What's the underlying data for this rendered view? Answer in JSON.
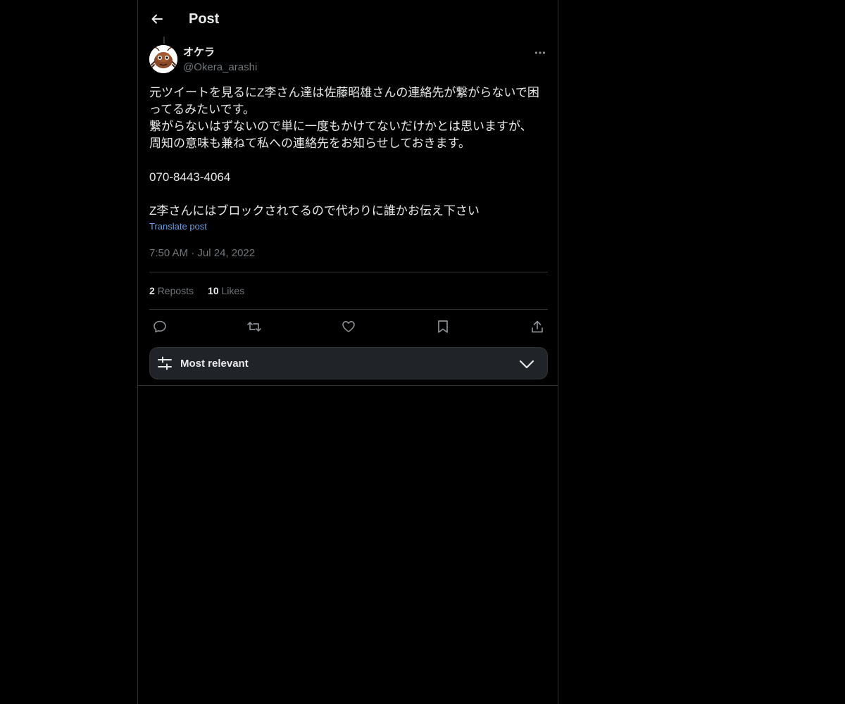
{
  "header": {
    "title": "Post",
    "back_icon": "arrow-left-icon"
  },
  "post": {
    "author": {
      "name": "オケラ",
      "handle": "@Okera_arashi",
      "avatar_icon": "cricket-avatar"
    },
    "text": "元ツイートを見るにZ李さん達は佐藤昭雄さんの連絡先が繋がらないで困ってるみたいです。\n繋がらないはずないので単に一度もかけてないだけかとは思いますが、\n周知の意味も兼ねて私への連絡先をお知らせしておきます。\n\n070-8443-4064\n\nZ李さんにはブロックされてるので代わりに誰かお伝え下さい",
    "translate_label": "Translate post",
    "time": "7:50 AM",
    "separator": "·",
    "date": "Jul 24, 2022"
  },
  "stats": {
    "reposts_count": "2",
    "reposts_label": "Reposts",
    "likes_count": "10",
    "likes_label": "Likes"
  },
  "actions": [
    "reply-icon",
    "repost-icon",
    "like-icon",
    "bookmark-icon",
    "share-icon"
  ],
  "sort": {
    "label": "Most relevant",
    "icon": "sliders-icon",
    "chevron": "chevron-down-icon"
  },
  "colors": {
    "background": "#000000",
    "text": "#e7e9ea",
    "muted": "#71767b",
    "link": "#6b9fe4",
    "border": "#2f3336",
    "sort_bg": "#202327"
  }
}
